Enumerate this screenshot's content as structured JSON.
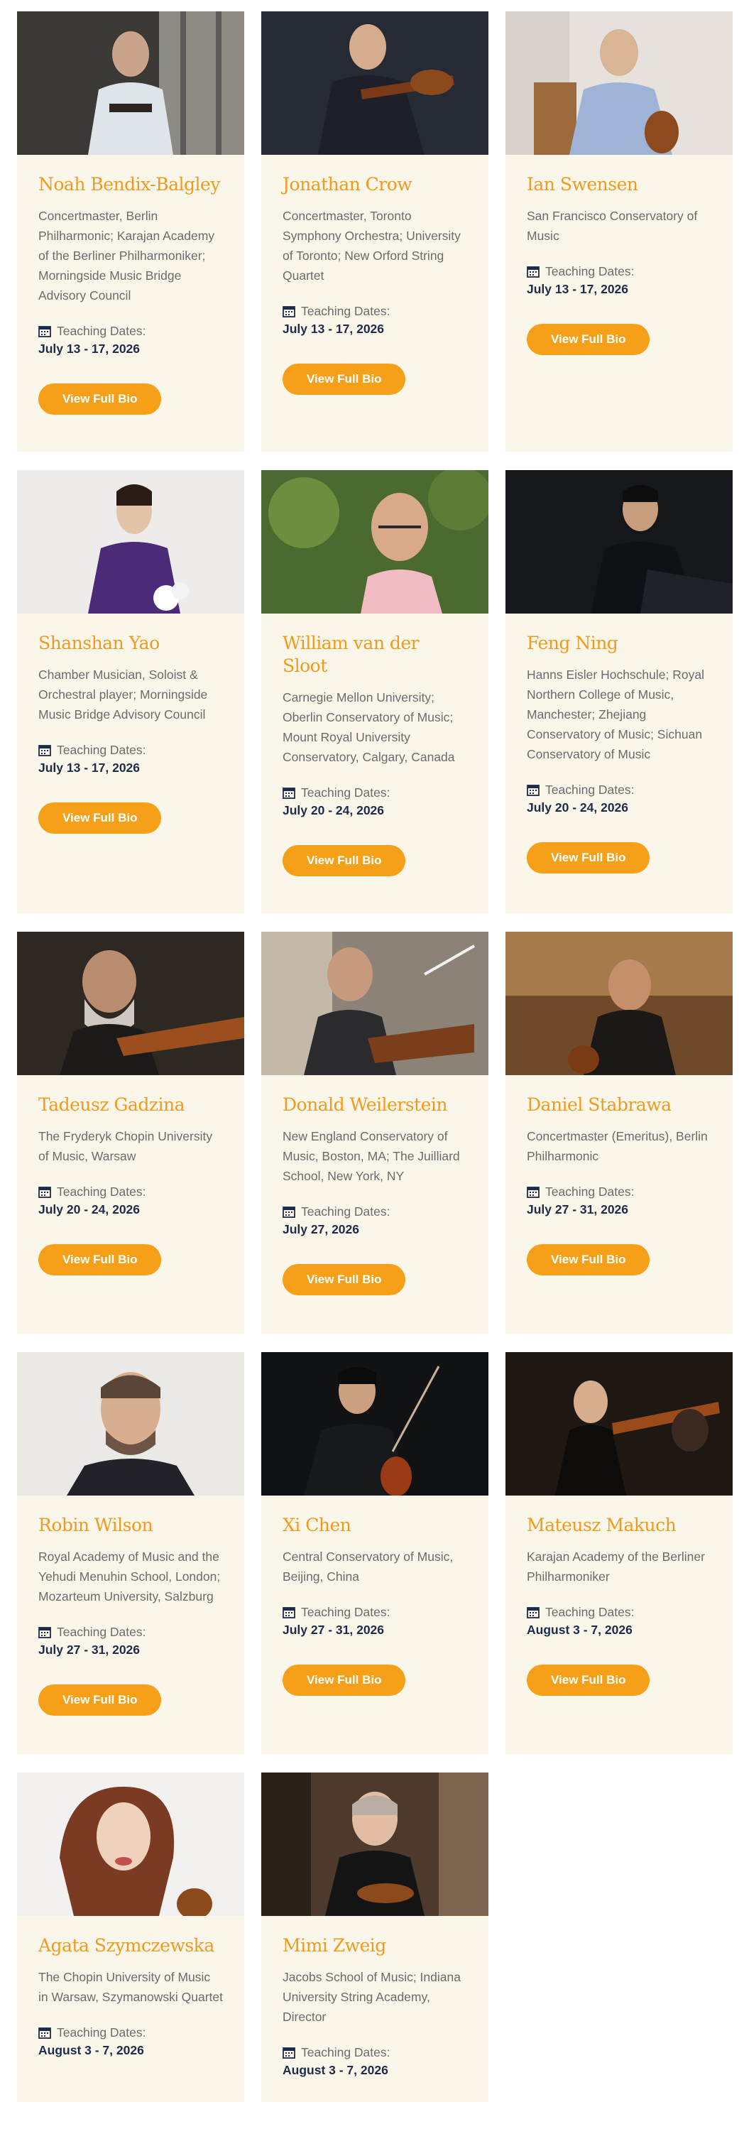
{
  "section": {
    "teaching_dates_label": "Teaching Dates:",
    "button_label": "View Full Bio"
  },
  "faculty": [
    {
      "name": "Noah Bendix-Balgley",
      "affiliation": "Concertmaster, Berlin Philharmonic; Karajan Academy of the Berliner Philharmoniker; Morningside Music Bridge Advisory Council",
      "dates": "July 13 - 17, 2026"
    },
    {
      "name": "Jonathan Crow",
      "affiliation": "Concertmaster, Toronto Symphony Orchestra; University of Toronto; New Orford String Quartet",
      "dates": "July 13 - 17, 2026"
    },
    {
      "name": "Ian Swensen",
      "affiliation": "San Francisco Conservatory of Music",
      "dates": "July 13 - 17, 2026"
    },
    {
      "name": "Shanshan Yao",
      "affiliation": "Chamber Musician, Soloist & Orchestral player; Morningside Music Bridge Advisory Council",
      "dates": "July 13 - 17, 2026"
    },
    {
      "name": "William van der Sloot",
      "affiliation": "Carnegie Mellon University; Oberlin Conservatory of Music; Mount Royal University Conservatory, Calgary, Canada",
      "dates": "July 20 - 24, 2026"
    },
    {
      "name": "Feng Ning",
      "affiliation": "Hanns Eisler Hochschule; Royal Northern College of Music, Manchester; Zhejiang Conservatory of Music; Sichuan Conservatory of Music",
      "dates": "July 20 - 24, 2026"
    },
    {
      "name": "Tadeusz Gadzina",
      "affiliation": "The Fryderyk Chopin University of Music, Warsaw",
      "dates": "July 20 - 24, 2026"
    },
    {
      "name": "Donald Weilerstein",
      "affiliation": "New England Conservatory of Music, Boston, MA; The Juilliard School, New York, NY",
      "dates": "July 27, 2026"
    },
    {
      "name": "Daniel Stabrawa",
      "affiliation": "Concertmaster (Emeritus), Berlin Philharmonic",
      "dates": "July 27 - 31, 2026"
    },
    {
      "name": "Robin Wilson",
      "affiliation": "Royal Academy of Music and the Yehudi Menuhin School, London; Mozarteum University, Salzburg",
      "dates": "July 27 - 31, 2026"
    },
    {
      "name": "Xi Chen",
      "affiliation": "Central Conservatory of Music, Beijing, China",
      "dates": "July 27 - 31, 2026"
    },
    {
      "name": "Mateusz Makuch",
      "affiliation": "Karajan Academy of the Berliner Philharmoniker",
      "dates": "August 3 - 7, 2026"
    },
    {
      "name": "Agata Szymczewska",
      "affiliation": "The Chopin University of Music in Warsaw, Szymanowski Quartet",
      "dates": "August 3 - 7, 2026"
    },
    {
      "name": "Mimi Zweig",
      "affiliation": "Jacobs School of Music; Indiana University String Academy, Director",
      "dates": "August 3 - 7, 2026"
    }
  ],
  "colors": {
    "accent": "#f6a019",
    "name": "#f39a1d",
    "card_bg": "#fbf6ea",
    "date_text": "#1e2b4a"
  }
}
